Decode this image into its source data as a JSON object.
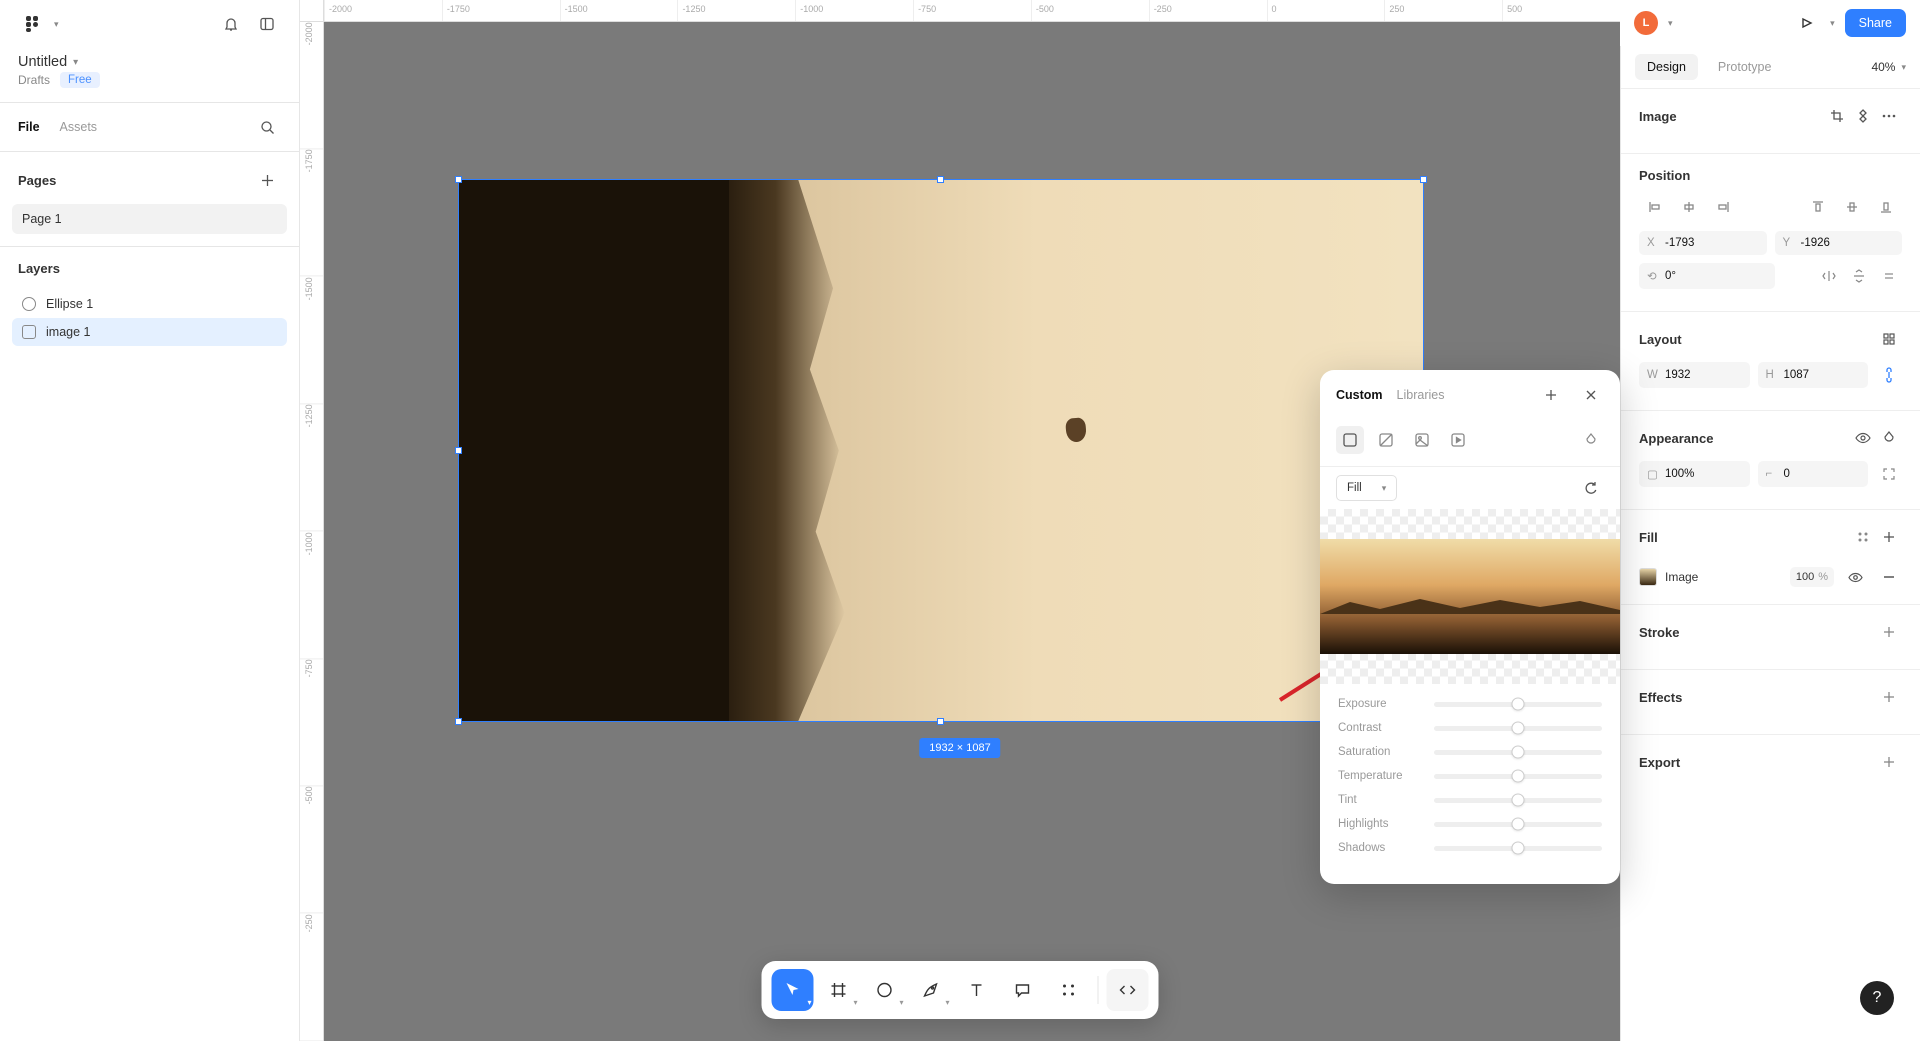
{
  "header": {
    "filename": "Untitled",
    "location": "Drafts",
    "plan_badge": "Free",
    "avatar_initial": "L",
    "share_label": "Share"
  },
  "left_panel": {
    "tab_file": "File",
    "tab_assets": "Assets",
    "pages_title": "Pages",
    "pages": [
      "Page 1"
    ],
    "layers_title": "Layers",
    "layers": [
      {
        "name": "Ellipse 1",
        "type": "ellipse",
        "selected": false
      },
      {
        "name": "image 1",
        "type": "image",
        "selected": true
      }
    ]
  },
  "canvas": {
    "ruler_h": [
      "-2000",
      "-1750",
      "-1500",
      "-1250",
      "-1000",
      "-750",
      "-500",
      "-250",
      "0",
      "250",
      "500"
    ],
    "ruler_v": [
      "-2000",
      "-1750",
      "-1500",
      "-1250",
      "-1000",
      "-750",
      "-500",
      "-250"
    ],
    "selection_dimensions": "1932 × 1087"
  },
  "right_panel": {
    "tab_design": "Design",
    "tab_prototype": "Prototype",
    "zoom": "40%",
    "section_image": "Image",
    "section_position": "Position",
    "pos_x": "-1793",
    "pos_y": "-1926",
    "rotation": "0°",
    "section_layout": "Layout",
    "width": "1932",
    "height": "1087",
    "section_appearance": "Appearance",
    "opacity": "100%",
    "corner_radius": "0",
    "section_fill": "Fill",
    "fill_label": "Image",
    "fill_opacity": "100",
    "fill_unit": "%",
    "section_stroke": "Stroke",
    "section_effects": "Effects",
    "section_export": "Export"
  },
  "image_popover": {
    "tab_custom": "Custom",
    "tab_libraries": "Libraries",
    "fill_mode": "Fill",
    "sliders": [
      "Exposure",
      "Contrast",
      "Saturation",
      "Temperature",
      "Tint",
      "Highlights",
      "Shadows"
    ]
  }
}
